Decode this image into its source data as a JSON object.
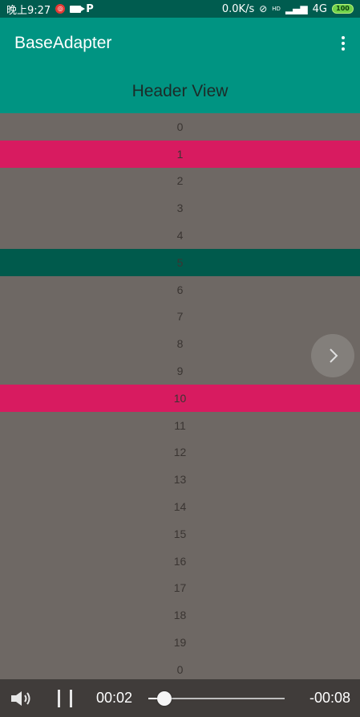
{
  "status_bar": {
    "time": "晚上9:27",
    "net_speed": "0.0K/s",
    "hd_label": "HD",
    "network": "4G",
    "battery": "100",
    "p_label": "P"
  },
  "app_bar": {
    "title": "BaseAdapter",
    "icon": "more-vert-icon"
  },
  "header": {
    "text": "Header View"
  },
  "list": {
    "rows": [
      {
        "label": "0",
        "highlight": "none"
      },
      {
        "label": "1",
        "highlight": "pink"
      },
      {
        "label": "2",
        "highlight": "none"
      },
      {
        "label": "3",
        "highlight": "none"
      },
      {
        "label": "4",
        "highlight": "none"
      },
      {
        "label": "5",
        "highlight": "green"
      },
      {
        "label": "6",
        "highlight": "none"
      },
      {
        "label": "7",
        "highlight": "none"
      },
      {
        "label": "8",
        "highlight": "none"
      },
      {
        "label": "9",
        "highlight": "none"
      },
      {
        "label": "10",
        "highlight": "pink"
      },
      {
        "label": "11",
        "highlight": "none"
      },
      {
        "label": "12",
        "highlight": "none"
      },
      {
        "label": "13",
        "highlight": "none"
      },
      {
        "label": "14",
        "highlight": "none"
      },
      {
        "label": "15",
        "highlight": "none"
      },
      {
        "label": "16",
        "highlight": "none"
      },
      {
        "label": "17",
        "highlight": "none"
      },
      {
        "label": "18",
        "highlight": "none"
      },
      {
        "label": "19",
        "highlight": "none"
      },
      {
        "label": "0",
        "highlight": "none"
      }
    ]
  },
  "player": {
    "elapsed": "00:02",
    "remaining": "-00:08",
    "progress": 0.12,
    "icons": [
      "volume-icon",
      "pause-icon",
      "chevron-right-icon"
    ]
  },
  "colors": {
    "primary": "#009482",
    "status_bar": "#005c4f",
    "pink": "#d81b60",
    "green": "#005a4c",
    "list_bg": "#6e6864"
  }
}
